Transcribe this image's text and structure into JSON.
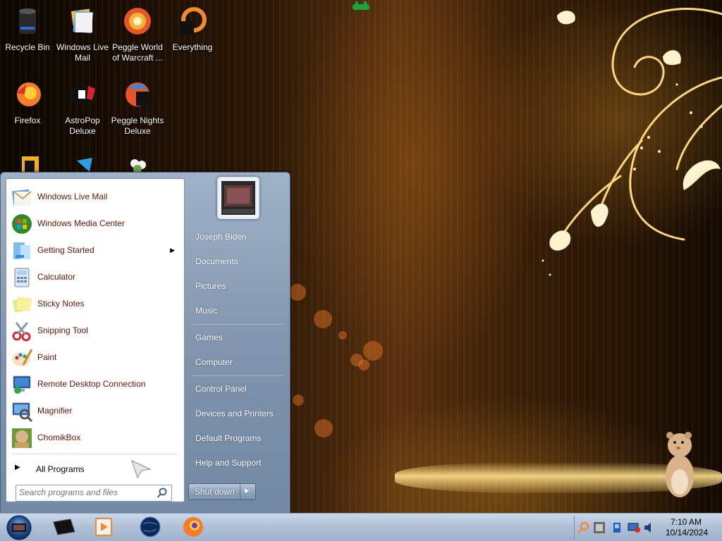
{
  "desktop": {
    "icons": [
      {
        "label": "Recycle Bin"
      },
      {
        "label": "Windows Live Mail"
      },
      {
        "label": "Peggle World of Warcraft ..."
      },
      {
        "label": "Everything"
      },
      {
        "label": "Firefox"
      },
      {
        "label": "AstroPop Deluxe"
      },
      {
        "label": "Peggle Nights Deluxe"
      }
    ]
  },
  "start_menu": {
    "programs": [
      {
        "label": "Windows Live Mail",
        "icon": "mail-icon"
      },
      {
        "label": "Windows Media Center",
        "icon": "media-center-icon"
      },
      {
        "label": "Getting Started",
        "icon": "getting-started-icon",
        "submenu": "▶"
      },
      {
        "label": "Calculator",
        "icon": "calculator-icon"
      },
      {
        "label": "Sticky Notes",
        "icon": "sticky-notes-icon"
      },
      {
        "label": "Snipping Tool",
        "icon": "snipping-tool-icon"
      },
      {
        "label": "Paint",
        "icon": "paint-icon"
      },
      {
        "label": "Remote Desktop Connection",
        "icon": "remote-desktop-icon"
      },
      {
        "label": "Magnifier",
        "icon": "magnifier-icon"
      },
      {
        "label": "ChomikBox",
        "icon": "chomikbox-icon"
      }
    ],
    "all_programs": {
      "arrow": "▶",
      "label": "All Programs"
    },
    "search": {
      "placeholder": "Search programs and files"
    },
    "right_items": [
      {
        "label": "Joseph Biden"
      },
      {
        "label": "Documents"
      },
      {
        "label": "Pictures"
      },
      {
        "label": "Music"
      },
      {
        "label": "Games"
      },
      {
        "label": "Computer"
      },
      {
        "label": "Control Panel"
      },
      {
        "label": "Devices and Printers"
      },
      {
        "label": "Default Programs"
      },
      {
        "label": "Help and Support"
      }
    ],
    "shutdown": {
      "label": "Shut down",
      "arrow": "▶"
    }
  },
  "taskbar": {
    "pinned": [
      {
        "name": "terminal-icon"
      },
      {
        "name": "media-player-icon"
      },
      {
        "name": "globe-icon"
      },
      {
        "name": "firefox-icon"
      }
    ],
    "clock": {
      "time": "7:10 AM",
      "date": "10/14/2024"
    }
  },
  "colors": {
    "program_label": "#6a1402",
    "taskbar": "#aebfd6",
    "start_menu_right": "#8195af"
  }
}
